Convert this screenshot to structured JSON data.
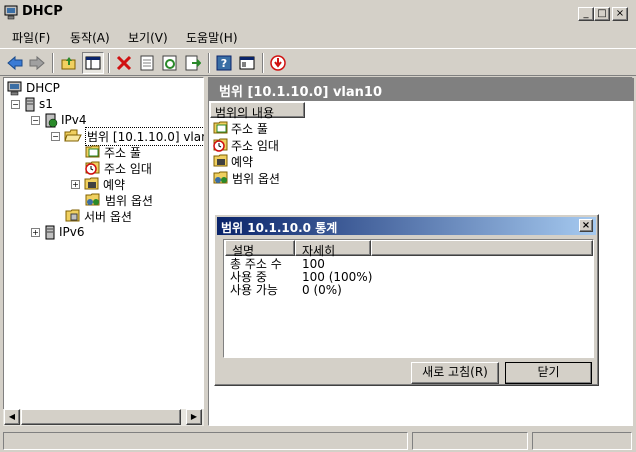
{
  "window": {
    "title": "DHCP",
    "controls": [
      "_",
      "□",
      "×"
    ]
  },
  "menu": {
    "items": [
      "파일(F)",
      "동작(A)",
      "보기(V)",
      "도움말(H)"
    ]
  },
  "toolbar": {
    "icons": [
      "back-icon",
      "forward-icon",
      "up-folder-icon",
      "show-hide-tree-icon",
      "delete-icon",
      "properties-icon",
      "refresh-icon",
      "export-list-icon",
      "help-icon",
      "view-icon",
      "stop-icon"
    ]
  },
  "tree": {
    "root": "DHCP",
    "server": "s1",
    "ipv4": "IPv4",
    "scope": "범위 [10.1.10.0] vlan",
    "address_pool": "주소 풀",
    "address_leases": "주소 임대",
    "reservations": "예약",
    "scope_options": "범위 옵션",
    "server_options": "서버 옵션",
    "ipv6": "IPv6"
  },
  "right": {
    "header": "범위 [10.1.10.0] vlan10",
    "column_header": "범위의 내용",
    "items": [
      "주소 풀",
      "주소 임대",
      "예약",
      "범위 옵션"
    ]
  },
  "dialog": {
    "title": "범위 10.1.10.0 통계",
    "col_description": "설명",
    "col_details": "자세히",
    "rows": [
      {
        "label": "총 주소 수",
        "value": "100"
      },
      {
        "label": "사용 중",
        "value": "100 (100%)"
      },
      {
        "label": "사용 가능",
        "value": "0 (0%)"
      }
    ],
    "refresh_button": "새로 고침(R)",
    "close_button": "닫기"
  },
  "colors": {
    "face": "#d4d0c8",
    "title_gradient_start": "#0a246a",
    "title_gradient_end": "#a6caf0",
    "pane_header": "#808080"
  }
}
